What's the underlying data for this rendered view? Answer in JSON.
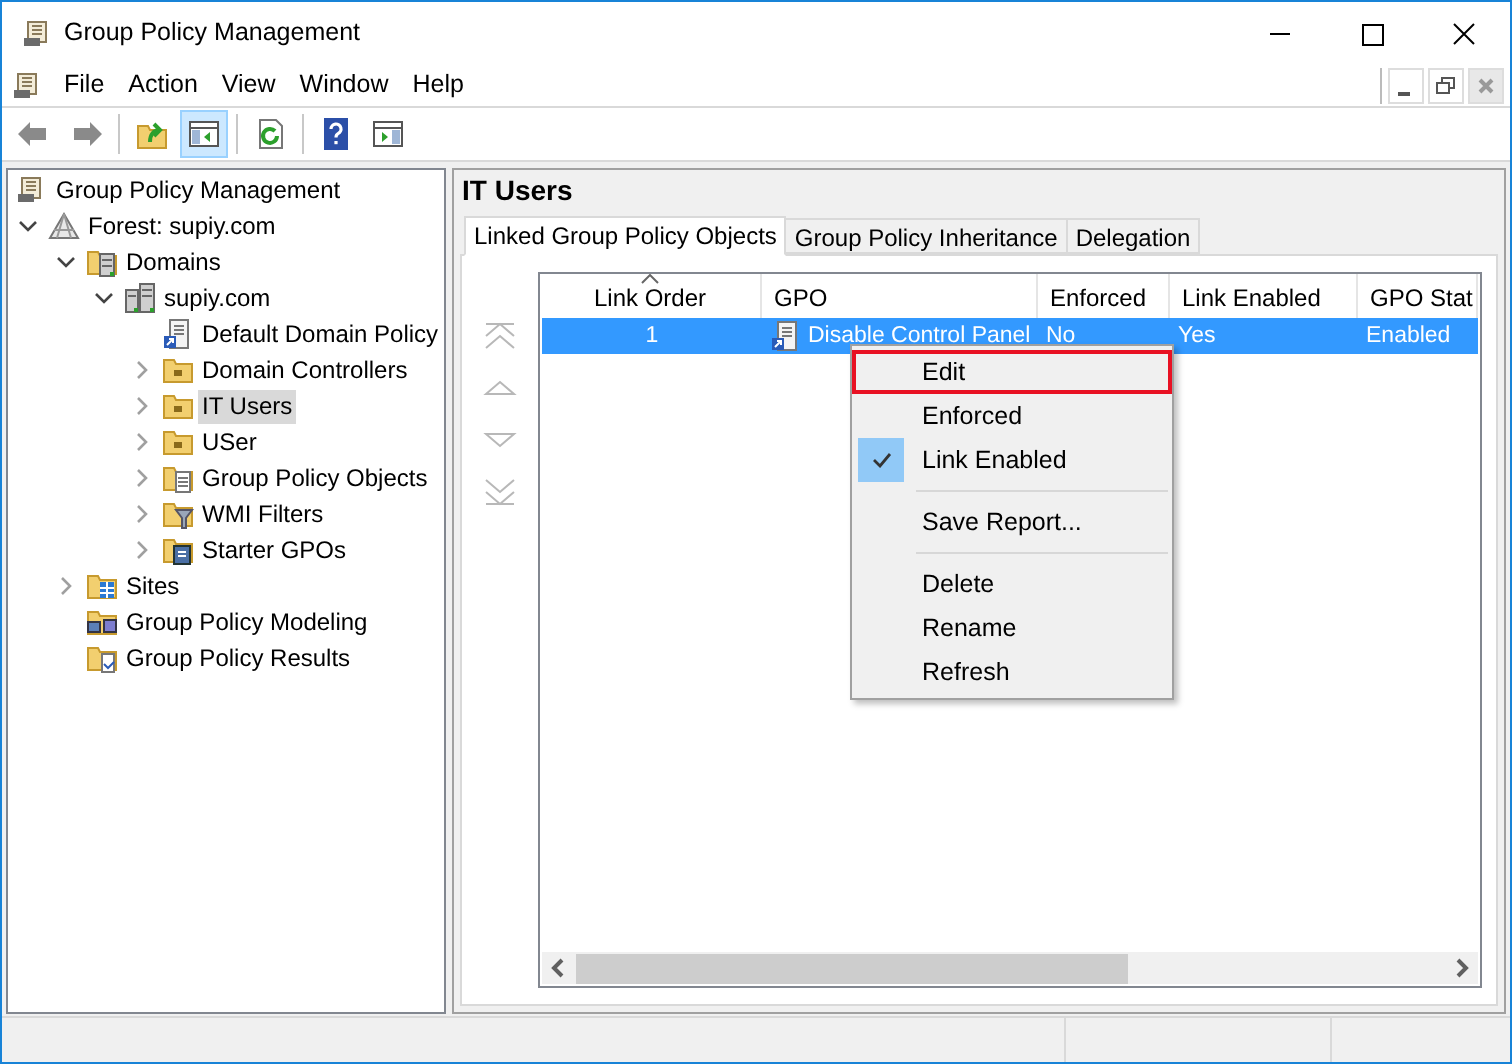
{
  "window": {
    "title": "Group Policy Management"
  },
  "menu_bar": [
    "File",
    "Action",
    "View",
    "Window",
    "Help"
  ],
  "toolbar": [
    [
      {
        "kind": "back",
        "pressed": false
      },
      {
        "kind": "forward",
        "pressed": false
      }
    ],
    [
      {
        "kind": "up",
        "pressed": false
      },
      {
        "kind": "tree",
        "pressed": true
      }
    ],
    [
      {
        "kind": "refresh",
        "pressed": false
      }
    ],
    [
      {
        "kind": "help",
        "pressed": false
      },
      {
        "kind": "action",
        "pressed": false
      }
    ]
  ],
  "tree": {
    "label": "Group Policy Management",
    "kind": "gpm",
    "selected": false,
    "children": [
      {
        "label": "Forest: supiy.com",
        "kind": "forest",
        "expanded": true,
        "selected": false,
        "children": [
          {
            "label": "Domains",
            "kind": "domains",
            "expanded": true,
            "selected": false,
            "children": [
              {
                "label": "supiy.com",
                "kind": "domain",
                "expanded": true,
                "selected": false,
                "children": [
                  {
                    "label": "Default Domain Policy",
                    "kind": "gpo-link",
                    "selected": false
                  },
                  {
                    "label": "Domain Controllers",
                    "kind": "ou",
                    "expanded": false,
                    "selected": false
                  },
                  {
                    "label": "IT Users",
                    "kind": "ou",
                    "expanded": false,
                    "selected": true
                  },
                  {
                    "label": "USer",
                    "kind": "ou",
                    "expanded": false,
                    "selected": false
                  },
                  {
                    "label": "Group Policy Objects",
                    "kind": "gpo-folder",
                    "expanded": false,
                    "selected": false
                  },
                  {
                    "label": "WMI Filters",
                    "kind": "wmi",
                    "expanded": false,
                    "selected": false
                  },
                  {
                    "label": "Starter GPOs",
                    "kind": "starter",
                    "expanded": false,
                    "selected": false
                  }
                ]
              }
            ]
          },
          {
            "label": "Sites",
            "kind": "sites",
            "expanded": false,
            "selected": false
          },
          {
            "label": "Group Policy Modeling",
            "kind": "modeling",
            "selected": false
          },
          {
            "label": "Group Policy Results",
            "kind": "results",
            "selected": false
          }
        ]
      }
    ]
  },
  "details": {
    "title": "IT Users",
    "tabs": [
      {
        "label": "Linked Group Policy Objects",
        "selected": true
      },
      {
        "label": "Group Policy Inheritance",
        "selected": false
      },
      {
        "label": "Delegation",
        "selected": false
      }
    ],
    "table": {
      "columns": [
        {
          "label": "Link Order",
          "sorted": true
        },
        {
          "label": "GPO",
          "sorted": false
        },
        {
          "label": "Enforced",
          "sorted": false
        },
        {
          "label": "Link Enabled",
          "sorted": false
        },
        {
          "label": "GPO Stat",
          "sorted": false
        }
      ],
      "rows": [
        {
          "cells": [
            "1",
            "Disable Control Panel",
            "No",
            "Yes",
            "Enabled"
          ],
          "selected": true
        }
      ]
    }
  },
  "context_menu": [
    {
      "kind": "item",
      "label": "Edit",
      "checked": false,
      "highlighted": true
    },
    {
      "kind": "item",
      "label": "Enforced",
      "checked": false,
      "highlighted": false
    },
    {
      "kind": "item",
      "label": "Link Enabled",
      "checked": true,
      "highlighted": false
    },
    {
      "kind": "separator"
    },
    {
      "kind": "item",
      "label": "Save Report...",
      "checked": false,
      "highlighted": false
    },
    {
      "kind": "separator"
    },
    {
      "kind": "item",
      "label": "Delete",
      "checked": false,
      "highlighted": false
    },
    {
      "kind": "item",
      "label": "Rename",
      "checked": false,
      "highlighted": false
    },
    {
      "kind": "item",
      "label": "Refresh",
      "checked": false,
      "highlighted": false
    }
  ]
}
